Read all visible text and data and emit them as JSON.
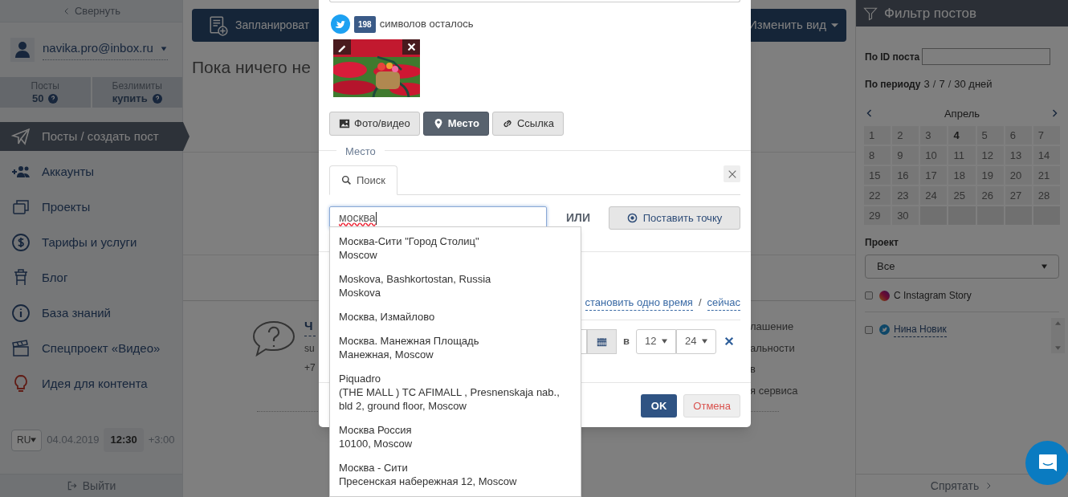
{
  "sidebar": {
    "collapse": "Свернуть",
    "user": "navika.pro@inbox.ru",
    "stats": [
      {
        "label": "Посты",
        "value": "50"
      },
      {
        "label": "Безлимиты",
        "value": "купить"
      }
    ],
    "nav": [
      {
        "label": "Посты / создать пост",
        "selected": true
      },
      {
        "label": "Аккаунты",
        "selected": false
      },
      {
        "label": "Проекты",
        "selected": false
      },
      {
        "label": "Тарифы и услуги",
        "selected": false
      },
      {
        "label": "Блог",
        "selected": false
      },
      {
        "label": "База знаний",
        "selected": false
      },
      {
        "label": "Спецпроект «Видео»",
        "selected": false
      },
      {
        "label": "Идея для контента",
        "selected": false
      }
    ],
    "footer": {
      "lang": "RU",
      "date": "04.04.2019",
      "time": "12:30",
      "tz": "+3:00",
      "logout": "Выйти"
    }
  },
  "toolbar": {
    "schedule_button": "Запланироват",
    "view_button": "Изменить вид"
  },
  "heading": "Пока ничего не",
  "support": {
    "title": "Ч",
    "email": "su",
    "phone": "+7",
    "links": [
      "лашение",
      "альности",
      "в",
      "я сервиса"
    ]
  },
  "modal": {
    "char_counter": {
      "count": "198",
      "text": "символов осталось"
    },
    "attach_buttons": [
      {
        "label": "Фото/видео",
        "selected": false
      },
      {
        "label": "Место",
        "selected": true
      },
      {
        "label": "Ссылка",
        "selected": false
      }
    ],
    "place": {
      "legend": "Место",
      "tab": "Поиск",
      "query": "москва",
      "or": "ИЛИ",
      "point_button": "Поставить точку",
      "suggestions": [
        {
          "title": "Москва-Сити \"Город Столиц\"",
          "subtitle": "Moscow"
        },
        {
          "title": "Moskova, Bashkortostan, Russia",
          "subtitle": "Moskova"
        },
        {
          "title": "Москва, Измайлово"
        },
        {
          "title": "Москва. Манежная Площадь",
          "subtitle": "Манежная, Moscow"
        },
        {
          "title": "Piquadro",
          "subtitle": "(THE MALL ) TC AFIMALL , Presnenskaja nab., bld 2, ground floor, Moscow"
        },
        {
          "title": "Москва Россия",
          "subtitle": "10100, Moscow"
        },
        {
          "title": "Москва - Сити",
          "subtitle": "Пресенская набережная 12, Moscow"
        }
      ]
    },
    "time": {
      "links": [
        "становить одно время",
        "сейчас"
      ],
      "separator": "/",
      "at": "в",
      "hour": "12",
      "minute": "24"
    },
    "ok": "OK",
    "cancel": "Отмена"
  },
  "filter": {
    "title": "Фильтр постов",
    "id_label": "По ID поста",
    "period_label": "По периоду",
    "periods": [
      "3",
      "7",
      "30 дней"
    ],
    "period_separator": "/",
    "month": "Апрель",
    "days": [
      {
        "day": "1",
        "today": false
      },
      {
        "day": "2",
        "today": false
      },
      {
        "day": "3",
        "today": false
      },
      {
        "day": "4",
        "today": true
      },
      {
        "day": "5",
        "today": false
      },
      {
        "day": "6",
        "today": false
      },
      {
        "day": "7",
        "today": false
      },
      {
        "day": "8",
        "today": false
      },
      {
        "day": "9",
        "today": false
      },
      {
        "day": "10",
        "today": false
      },
      {
        "day": "11",
        "today": false
      },
      {
        "day": "12",
        "today": false
      },
      {
        "day": "13",
        "today": false
      },
      {
        "day": "14",
        "today": false
      },
      {
        "day": "15",
        "today": false
      },
      {
        "day": "16",
        "today": false
      },
      {
        "day": "17",
        "today": false
      },
      {
        "day": "18",
        "today": false
      },
      {
        "day": "19",
        "today": false
      },
      {
        "day": "20",
        "today": false
      },
      {
        "day": "21",
        "today": false
      },
      {
        "day": "22",
        "today": false
      },
      {
        "day": "23",
        "today": false
      },
      {
        "day": "24",
        "today": false
      },
      {
        "day": "25",
        "today": false
      },
      {
        "day": "26",
        "today": false
      },
      {
        "day": "27",
        "today": false
      },
      {
        "day": "28",
        "today": false
      },
      {
        "day": "29",
        "today": false
      },
      {
        "day": "30",
        "today": false
      }
    ],
    "project_label": "Проект",
    "project": "Все",
    "options": [
      {
        "label": "С Instagram Story",
        "checked": false
      }
    ],
    "accounts": [
      {
        "name": "Нина Новик",
        "checked": false
      }
    ],
    "hide": "Спрятать"
  }
}
